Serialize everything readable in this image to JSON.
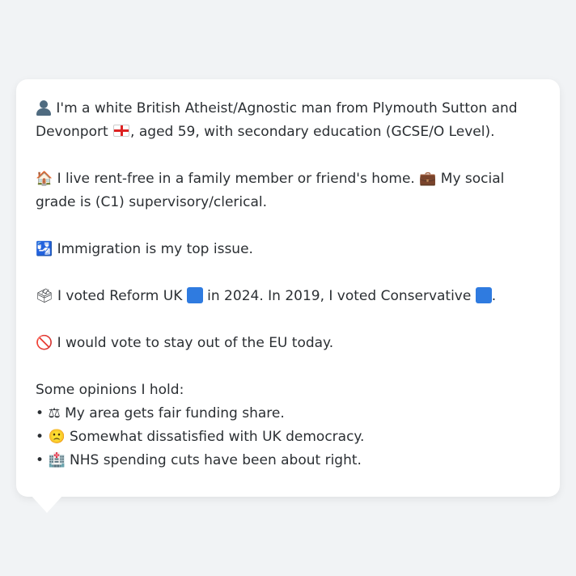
{
  "profile": {
    "intro_a": "I'm a white British Atheist/Agnostic man from Plymouth Sutton and",
    "intro_b": "Devonport",
    "intro_c": ", aged 59, with secondary education (GCSE/O Level).",
    "housing": "I live rent-free in a family member or friend's home.",
    "grade": "My social grade is (C1) supervisory/clerical.",
    "issue": "Immigration is my top issue.",
    "vote_a": "I voted Reform UK",
    "vote_b": "in 2024. In 2019, I voted Conservative",
    "vote_c": ".",
    "eu": "I would vote to stay out of the EU today.",
    "opinions_heading": "Some opinions I hold:",
    "opinions": [
      {
        "bullet": "•",
        "text": "My area gets fair funding share."
      },
      {
        "bullet": "•",
        "text": "Somewhat dissatisfied with UK democracy."
      },
      {
        "bullet": "•",
        "text": "NHS spending cuts have been about right."
      }
    ]
  },
  "icons": {
    "person": "person-icon",
    "flag": "england-flag-icon",
    "house": "🏠",
    "briefcase": "💼",
    "immigration": "🛂",
    "ballot": "🗳",
    "no_entry": "🚫",
    "scales": "⚖",
    "confused": "🙁",
    "hospital": "🏥"
  },
  "colors": {
    "reform_blue": "#2f7be0",
    "conservative_blue": "#2f7be0"
  }
}
